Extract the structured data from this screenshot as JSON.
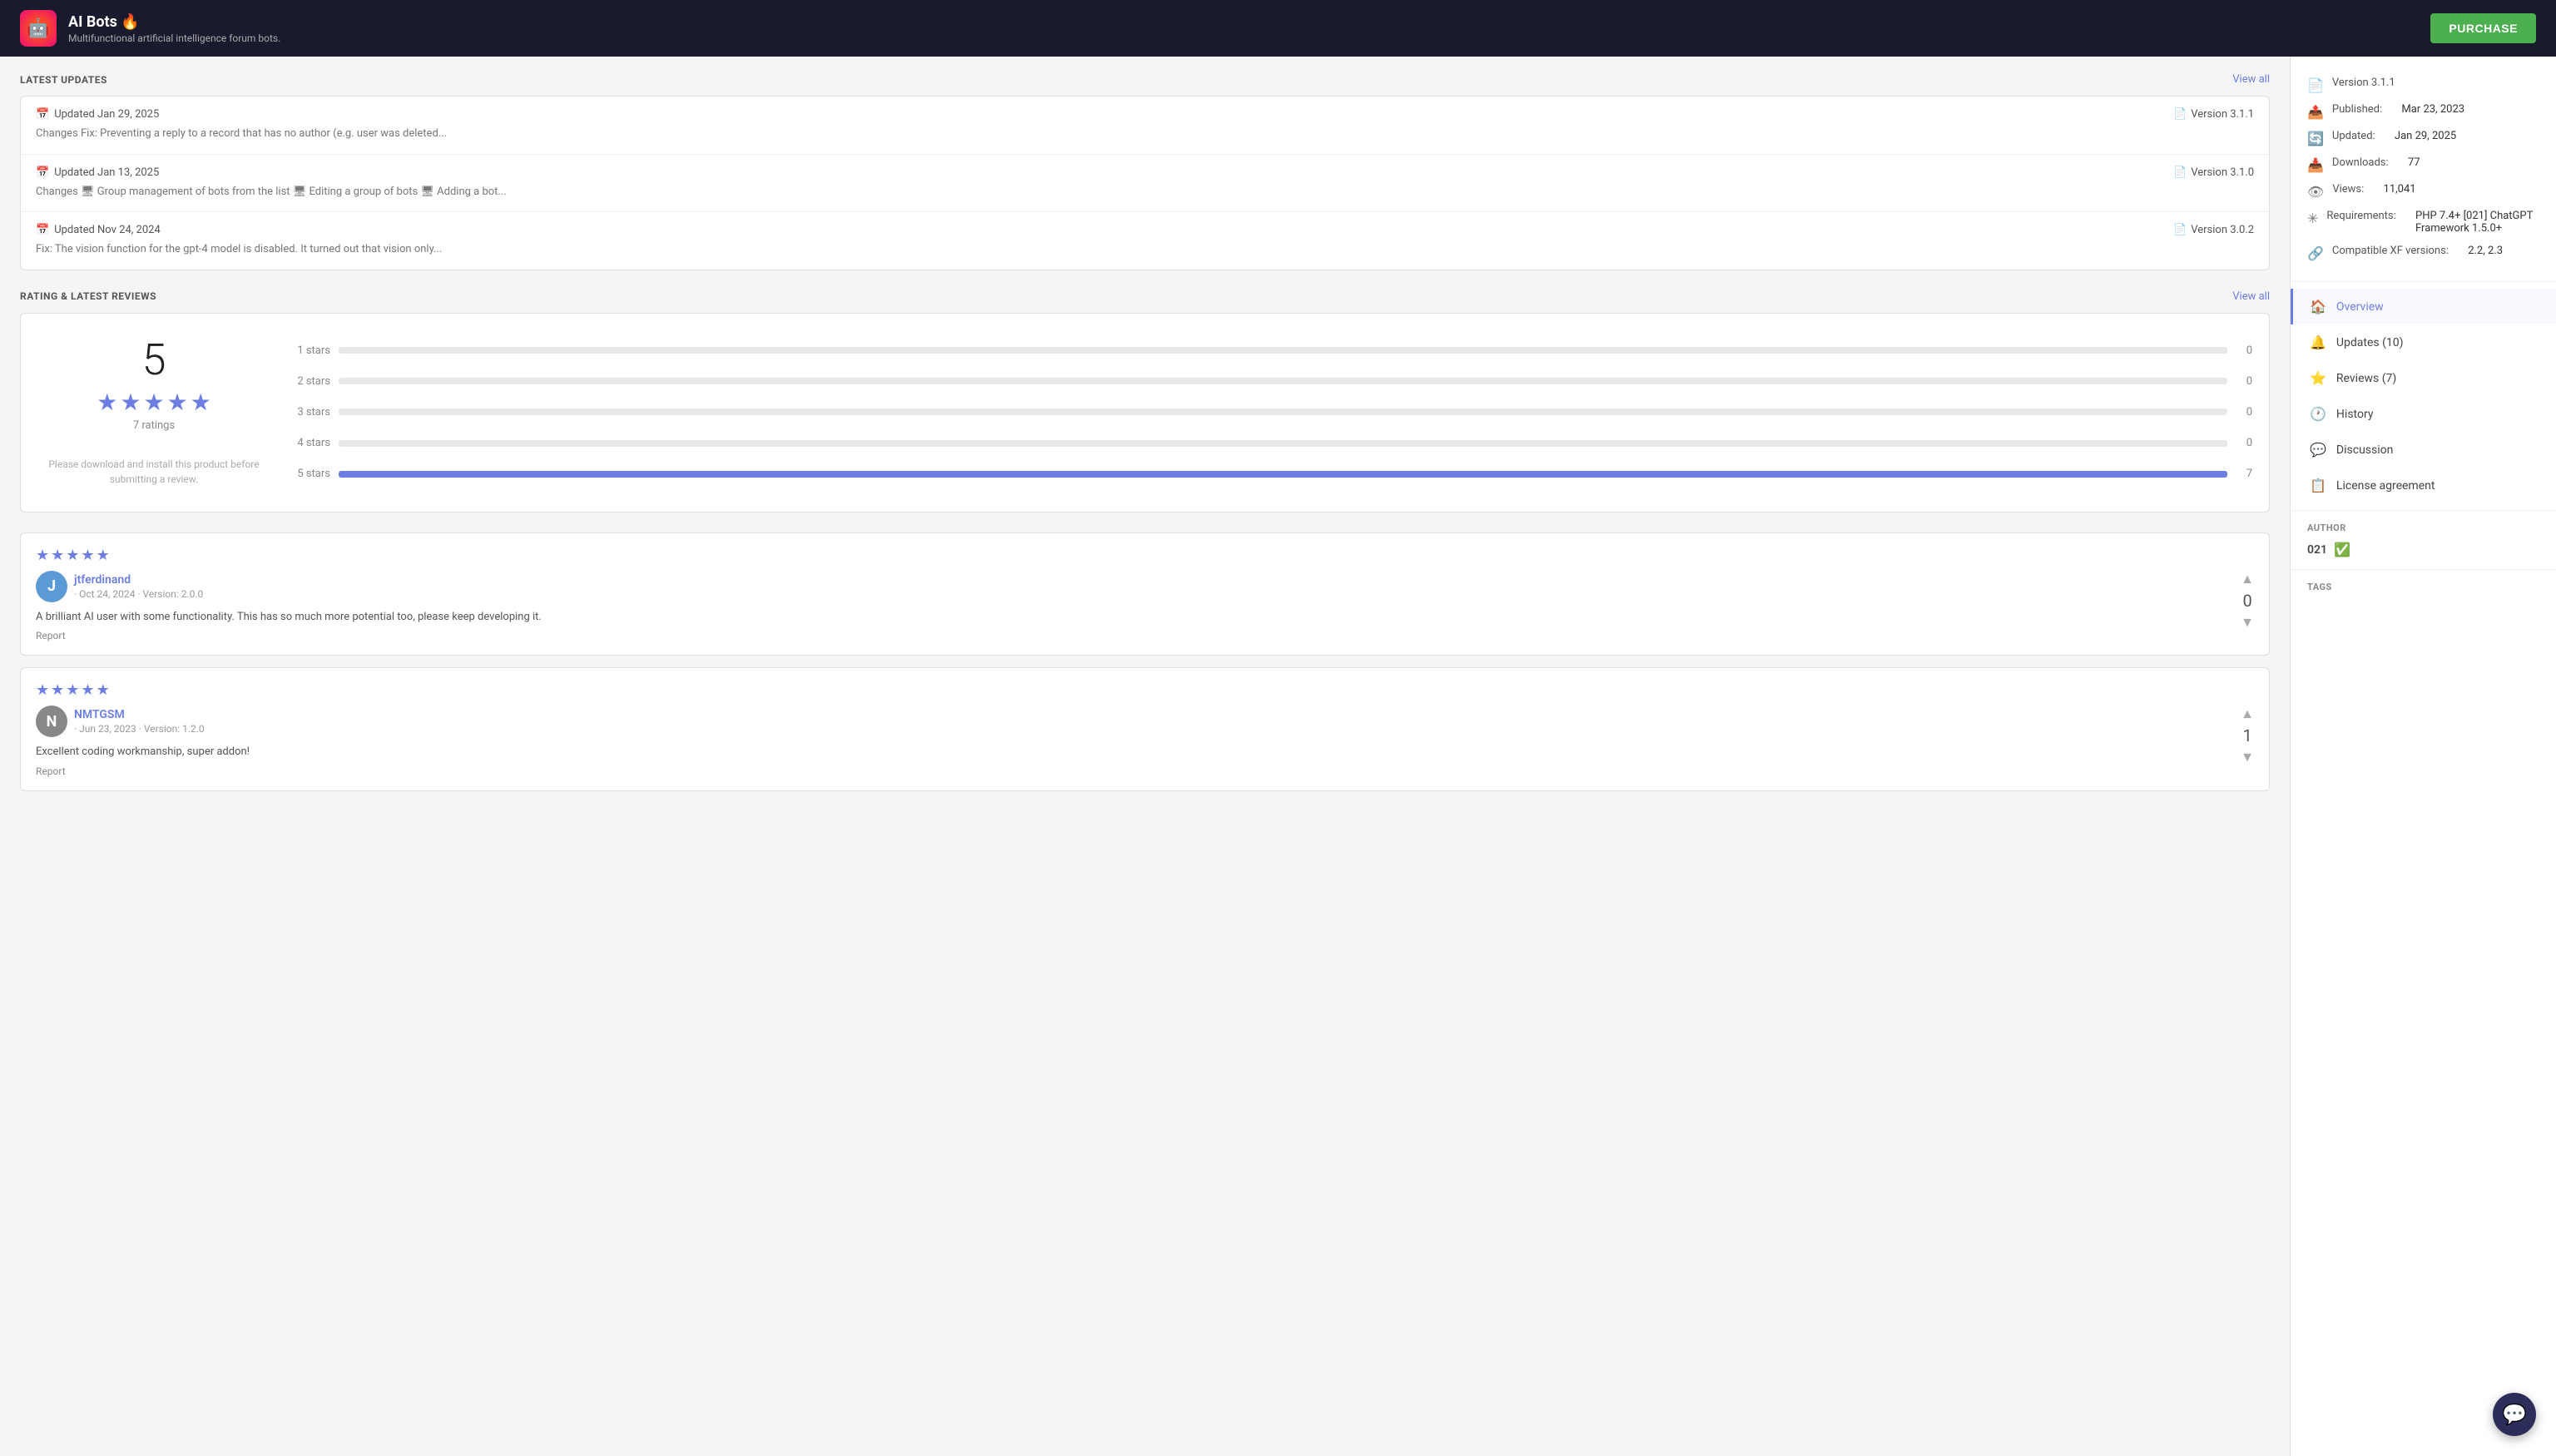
{
  "header": {
    "logo_emoji": "🤖",
    "title": "AI Bots 🔥",
    "subtitle": "Multifunctional artificial intelligence forum bots.",
    "purchase_label": "PURCHASE"
  },
  "latest_updates": {
    "section_title": "LATEST UPDATES",
    "view_all_label": "View all",
    "items": [
      {
        "date": "Updated Jan 29, 2025",
        "version": "Version 3.1.1",
        "description": "Changes Fix: Preventing a reply to a record that has no author (e.g. user was deleted..."
      },
      {
        "date": "Updated Jan 13, 2025",
        "version": "Version 3.1.0",
        "description": "Changes 🖥 Group management of bots from the list 🖥 Editing a group of bots 🖥 Adding a bot..."
      },
      {
        "date": "Updated Nov 24, 2024",
        "version": "Version 3.0.2",
        "description": "Fix: The vision function for the gpt-4 model is disabled. It turned out that vision only..."
      }
    ]
  },
  "ratings": {
    "section_title": "RATING & LATEST REVIEWS",
    "view_all_label": "View all",
    "average": "5",
    "count_label": "7 ratings",
    "download_note": "Please download and install this product before submitting a review.",
    "bars": [
      {
        "label": "1 stars",
        "fill_pct": 0,
        "count": "0"
      },
      {
        "label": "2 stars",
        "fill_pct": 0,
        "count": "0"
      },
      {
        "label": "3 stars",
        "fill_pct": 0,
        "count": "0"
      },
      {
        "label": "4 stars",
        "fill_pct": 0,
        "count": "0"
      },
      {
        "label": "5 stars",
        "fill_pct": 100,
        "count": "7"
      }
    ]
  },
  "reviews": [
    {
      "stars": 5,
      "avatar_letter": "J",
      "avatar_color": "#5c9ad6",
      "reviewer": "jtferdinand",
      "meta": "· Oct 24, 2024 · Version: 2.0.0",
      "text": "A brilliant AI user with some functionality. This has so much more potential too, please keep developing it.",
      "report_label": "Report",
      "vote": "0",
      "vote_up": "▲",
      "vote_down": "▼"
    },
    {
      "stars": 5,
      "avatar_letter": "N",
      "avatar_color": "#888",
      "reviewer": "NMTGSM",
      "meta": "· Jun 23, 2023 · Version: 1.2.0",
      "text": "Excellent coding workmanship, super addon!",
      "report_label": "Report",
      "vote": "1",
      "vote_up": "▲",
      "vote_down": "▼"
    }
  ],
  "sidebar": {
    "meta": {
      "version": {
        "icon": "📄",
        "label": "Version 3.1.1"
      },
      "published": {
        "icon": "📤",
        "label": "Published:",
        "value": "Mar 23, 2023"
      },
      "updated": {
        "icon": "🔄",
        "label": "Updated:",
        "value": "Jan 29, 2025"
      },
      "downloads": {
        "icon": "📥",
        "label": "Downloads:",
        "value": "77"
      },
      "views": {
        "icon": "👁",
        "label": "Views:",
        "value": "11,041"
      },
      "requirements": {
        "icon": "✳",
        "label": "Requirements:",
        "value": "PHP 7.4+ [021] ChatGPT Framework 1.5.0+"
      },
      "compatible": {
        "icon": "🔗",
        "label": "Compatible XF versions:",
        "value": "2.2, 2.3"
      }
    },
    "nav": [
      {
        "id": "overview",
        "icon": "🏠",
        "label": "Overview",
        "active": true
      },
      {
        "id": "updates",
        "icon": "🔔",
        "label": "Updates (10)",
        "active": false
      },
      {
        "id": "reviews",
        "icon": "⭐",
        "label": "Reviews (7)",
        "active": false
      },
      {
        "id": "history",
        "icon": "🕐",
        "label": "History",
        "active": false
      },
      {
        "id": "discussion",
        "icon": "💬",
        "label": "Discussion",
        "active": false
      },
      {
        "id": "license",
        "icon": "📋",
        "label": "License agreement",
        "active": false
      }
    ],
    "author_label": "AUTHOR",
    "author_name": "021",
    "tags_label": "TAGS"
  },
  "chat_fab_icon": "💬"
}
